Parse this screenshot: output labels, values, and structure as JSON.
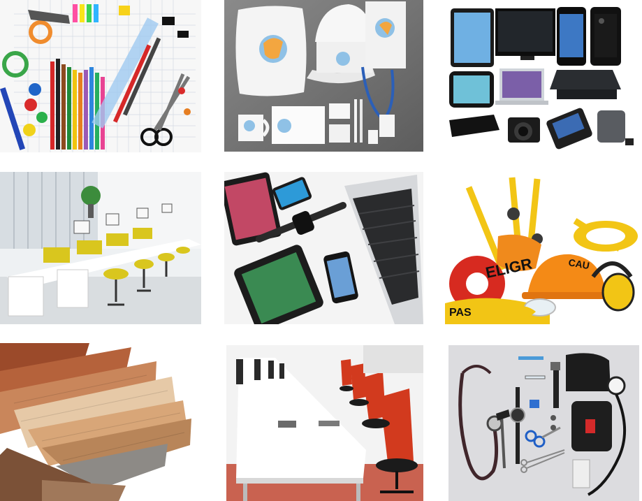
{
  "grid": {
    "columns": 3,
    "rows": 3,
    "tiles": [
      {
        "name": "office-stationery",
        "colors": {
          "bg": "#f4f4f4",
          "accent": "#e23b3b"
        }
      },
      {
        "name": "branded-merchandise",
        "colors": {
          "bg": "#6e6e6e",
          "accent": "#ffffff"
        }
      },
      {
        "name": "consumer-electronics",
        "colors": {
          "bg": "#ffffff",
          "accent": "#111111"
        }
      },
      {
        "name": "office-workstations",
        "colors": {
          "bg": "#eef1f3",
          "accent": "#d4c21b"
        }
      },
      {
        "name": "apple-devices",
        "colors": {
          "bg": "#f5f5f5",
          "accent": "#1f1f1f"
        }
      },
      {
        "name": "safety-equipment",
        "colors": {
          "bg": "#ffffff",
          "accent": "#f2c515"
        }
      },
      {
        "name": "wood-laminate-samples",
        "colors": {
          "bg": "#ffffff",
          "accent": "#9c5a33"
        }
      },
      {
        "name": "open-office-chairs",
        "colors": {
          "bg": "#f1f1f1",
          "accent": "#d23a1e"
        }
      },
      {
        "name": "medical-instruments",
        "colors": {
          "bg": "#d9d9dc",
          "accent": "#1d1d1d"
        }
      }
    ]
  },
  "safety_tape": {
    "text_1": "ELIGR",
    "text_2": "PAS",
    "text_3": "CAU"
  }
}
